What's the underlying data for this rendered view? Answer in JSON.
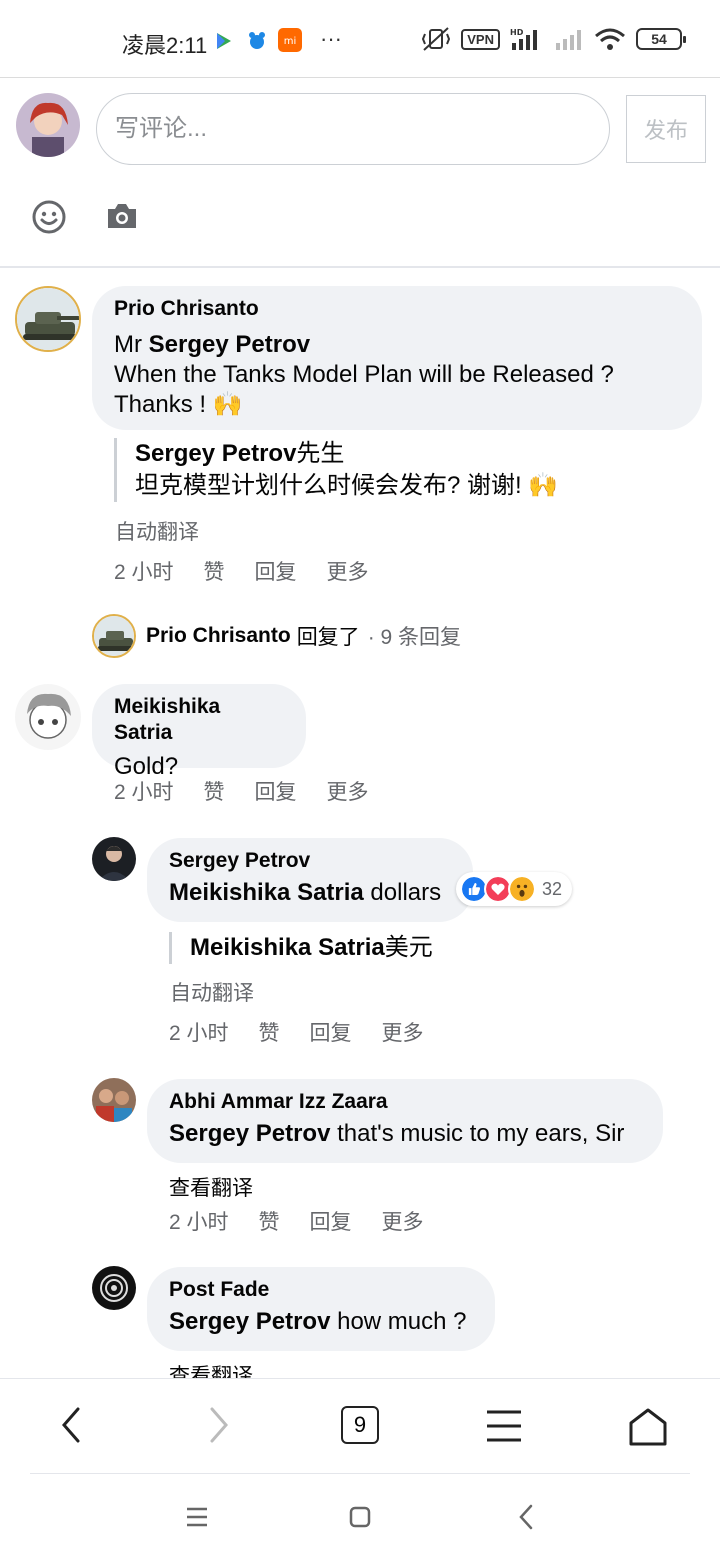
{
  "status_bar": {
    "time": "凌晨2:11",
    "more": "···",
    "vpn": "VPN",
    "hd": "HD",
    "battery": "54"
  },
  "composer": {
    "placeholder": "写评论...",
    "post_label": "发布"
  },
  "comments": [
    {
      "author": "Prio Chrisanto",
      "mention_prefix": "Mr ",
      "mention": "Sergey Petrov",
      "text": "When the Tanks Model Plan will be Released ?",
      "text2": "Thanks ! 🙌",
      "translation_mention": "Sergey Petrov",
      "translation_text": "先生",
      "translation_line2": "坦克模型计划什么时候会发布? 谢谢! 🙌",
      "auto_translated": "自动翻译",
      "time": "2 小时",
      "like": "赞",
      "reply": "回复",
      "more": "更多"
    },
    {
      "author": "Meikishika Satria",
      "text": "Gold?",
      "time": "2 小时",
      "like": "赞",
      "reply": "回复",
      "more": "更多"
    }
  ],
  "replies_summary": {
    "name": "Prio Chrisanto",
    "action": "回复了",
    "count": "· 9 条回复"
  },
  "replies": [
    {
      "author": "Sergey Petrov",
      "mention": "Meikishika Satria",
      "text": " dollars",
      "reaction_count": "32",
      "translation_mention": "Meikishika Satria",
      "translation_text": "美元",
      "auto_translated": "自动翻译",
      "time": "2 小时",
      "like": "赞",
      "reply": "回复",
      "more": "更多"
    },
    {
      "author": "Abhi Ammar Izz Zaara",
      "mention": "Sergey Petrov",
      "text": " that's music to my ears, Sir",
      "see_translation": "查看翻译",
      "time": "2 小时",
      "like": "赞",
      "reply": "回复",
      "more": "更多"
    },
    {
      "author": "Post Fade",
      "mention": "Sergey Petrov",
      "text": " how much ?",
      "see_translation": "查看翻译"
    }
  ],
  "browser_bar": {
    "tab_count": "9"
  },
  "colors": {
    "bubble": "#f0f2f5",
    "like_blue": "#1877f2",
    "love_red": "#f33e58",
    "wow_yellow": "#f7b125"
  }
}
